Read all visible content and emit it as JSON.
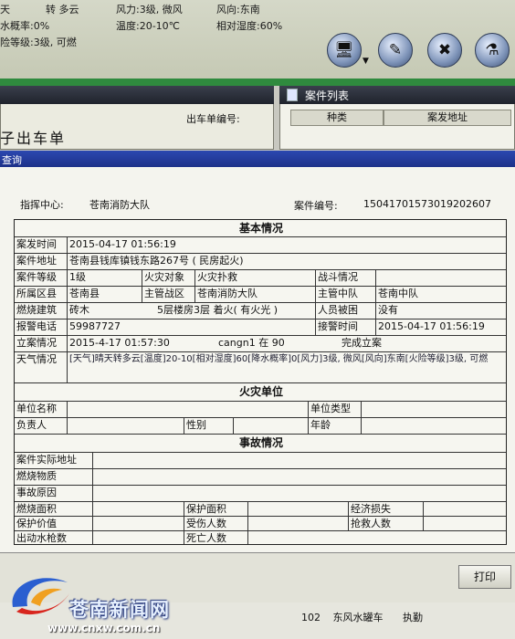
{
  "weather": {
    "sky": "天",
    "sky_change": "转 多云",
    "wind_force": "风力:3级, 微风",
    "wind_direction": "风向:东南",
    "rain_prob": "水概率:0%",
    "temperature": "温度:20-10℃",
    "humidity": "相对湿度:60%",
    "fire_risk": "险等级:3级, 可燃"
  },
  "left_panel": {
    "dispatch_no_label": "出车单编号:",
    "form_title": "子出车单"
  },
  "case_list": {
    "title": "案件列表",
    "columns": [
      "种类",
      "案发地址"
    ]
  },
  "dialog": {
    "title": "查询",
    "center_label": "指挥中心:",
    "center_value": "苍南消防大队",
    "case_no_label": "案件编号:",
    "case_no_value": "15041701573019202607"
  },
  "form": {
    "basic_title": "基本情况",
    "time_label": "案发时间",
    "time_value": "2015-04-17 01:56:19",
    "address_label": "案件地址",
    "address_value": "苍南县钱库镇钱东路267号 ( 民房起火)",
    "grade_label": "案件等级",
    "grade_value": "1级",
    "fire_object_label": "火灾对象",
    "fire_object_value": "火灾扑救",
    "battle_label": "战斗情况",
    "battle_value": "",
    "county_label": "所属区县",
    "county_value": "苍南县",
    "zone_label": "主管战区",
    "zone_value": "苍南消防大队",
    "squad_label": "主管中队",
    "squad_value": "苍南中队",
    "building_label": "燃烧建筑",
    "building_value": "砖木",
    "building_desc": "5层楼房3层  着火( 有火光 )",
    "trapped_label": "人员被困",
    "trapped_value": "没有",
    "phone_label": "报警电话",
    "phone_value": "59987727",
    "alarm_time_label": "接警时间",
    "alarm_time_value": "2015-04-17 01:56:19",
    "filing_label": "立案情况",
    "filing_time": "2015-4-17  01:57:30",
    "filing_user": "cangn1 在 90",
    "filing_status": "完成立案",
    "weather_label": "天气情况",
    "weather_value": "[天气]晴天转多云[温度]20-10[相对湿度]60[降水概率]0[风力]3级, 微风[风向]东南[火险等级]3级, 可燃",
    "unit_title": "火灾单位",
    "unit_name_label": "单位名称",
    "unit_type_label": "单位类型",
    "person_label": "负责人",
    "gender_label": "性别",
    "age_label": "年龄",
    "accident_title": "事故情况",
    "actual_address_label": "案件实际地址",
    "burn_material_label": "燃烧物质",
    "cause_label": "事故原因",
    "burn_area_label": "燃烧面积",
    "protect_area_label": "保护面积",
    "econ_loss_label": "经济损失",
    "protect_value_label": "保护价值",
    "injured_label": "受伤人数",
    "rescued_label": "抢救人数",
    "nozzle_label": "出动水枪数",
    "death_label": "死亡人数"
  },
  "footer": {
    "print_label": "打印",
    "list_no": "102",
    "list_vehicle": "东风水罐车",
    "list_status": "执勤"
  },
  "watermark": {
    "site_name": "苍南新闻网",
    "url": "www.cnxw.com.cn"
  },
  "icons": {
    "toolbar": [
      "monitor-icon",
      "pen-icon",
      "tools-icon",
      "bottles-icon"
    ]
  }
}
